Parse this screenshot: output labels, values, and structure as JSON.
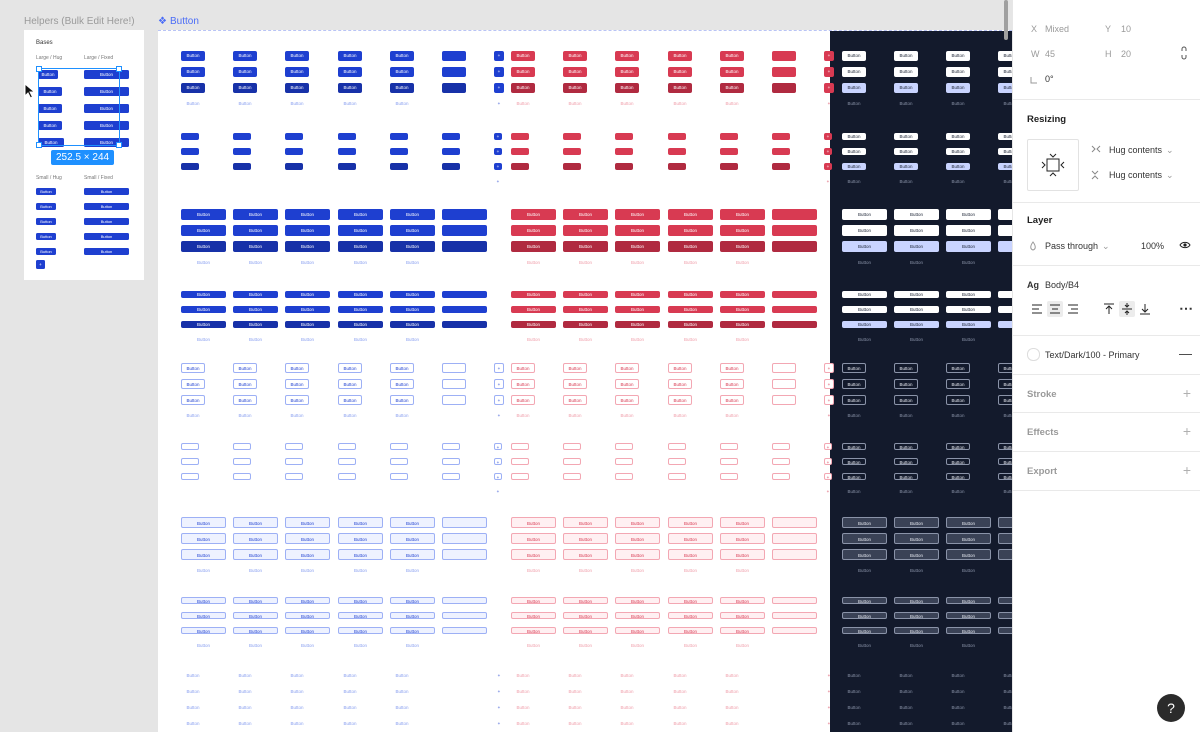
{
  "canvas": {
    "helpers_label": "Helpers (Bulk Edit Here!)",
    "button_label": "Button",
    "helpers": {
      "title": "Bases",
      "large_hug": "Large / Hug",
      "large_fixed": "Large / Fixed",
      "small_hug": "Small / Hug",
      "small_fixed": "Small / Fixed",
      "button_text": "Button"
    },
    "selection_size": "252.5 × 244",
    "button_text": "Button",
    "colors": {
      "blue": "#1e3fd0",
      "blue_dark": "#1731a8",
      "red": "#d83a52",
      "red_dark": "#b02a40",
      "dark_bg": "#131a2c"
    }
  },
  "properties": {
    "x_label": "X",
    "x_value": "Mixed",
    "y_label": "Y",
    "y_value": "10",
    "w_label": "W",
    "w_value": "45",
    "h_label": "H",
    "h_value": "20",
    "rotation": "0°",
    "resizing_title": "Resizing",
    "resizing_horizontal": "Hug contents",
    "resizing_vertical": "Hug contents",
    "layer_title": "Layer",
    "blend_mode": "Pass through",
    "opacity": "100%",
    "text_style_prefix": "Ag",
    "text_style": "Body/B4",
    "fill_style": "Text/Dark/100 - Primary",
    "stroke_title": "Stroke",
    "effects_title": "Effects",
    "export_title": "Export"
  },
  "help": "?"
}
